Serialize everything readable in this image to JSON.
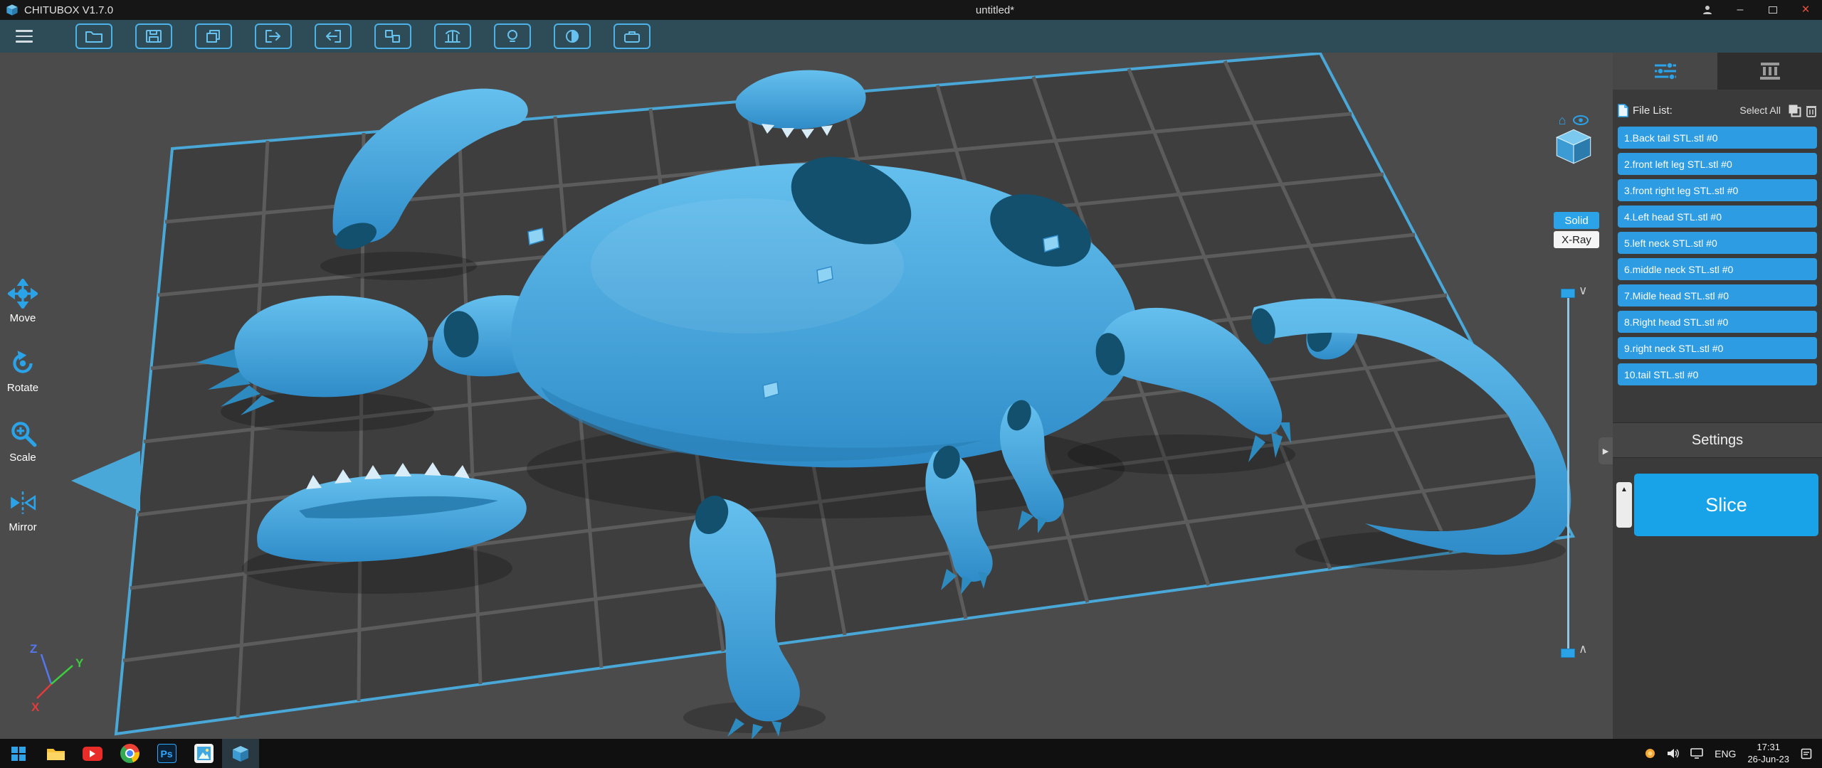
{
  "colors": {
    "accent": "#2ba3e8",
    "model_blue": "#3fa8e0",
    "slice_blue": "#18a3e8",
    "toolbar_bg": "#2d4c58",
    "viewport_bg": "#4b4b4b",
    "panel_bg": "#3a3a3a",
    "plate_outline": "#49a8d8",
    "close_red": "#ef5340"
  },
  "title_bar": {
    "app_title": "CHITUBOX V1.7.0",
    "document_title": "untitled*"
  },
  "toolbar": {
    "button_icons": [
      "open-file",
      "save",
      "copy",
      "import",
      "export",
      "clone",
      "support",
      "hollow",
      "dark-mode",
      "print-settings"
    ]
  },
  "left_toolbar": {
    "tools": [
      {
        "icon": "move-icon",
        "label": "Move"
      },
      {
        "icon": "rotate-icon",
        "label": "Rotate"
      },
      {
        "icon": "scale-icon",
        "label": "Scale"
      },
      {
        "icon": "mirror-icon",
        "label": "Mirror"
      }
    ]
  },
  "viewport": {
    "render_modes": {
      "solid": "Solid",
      "xray": "X-Ray"
    },
    "view_widget_icons": [
      "home-icon",
      "eye-icon",
      "view-cube"
    ],
    "axes": {
      "x": "X",
      "y": "Y",
      "z": "Z"
    }
  },
  "right_panel": {
    "tabs": [
      {
        "icon": "settings-sliders-icon",
        "active": true
      },
      {
        "icon": "printer-icon",
        "active": false
      }
    ],
    "file_list": {
      "label": "File List:",
      "select_all_label": "Select All",
      "icons": [
        "file-icon",
        "select-all-icon",
        "delete-icon"
      ],
      "files": [
        "1.Back tail STL.stl #0",
        "2.front left leg STL.stl #0",
        "3.front right leg STL.stl #0",
        "4.Left head STL.stl #0",
        "5.left neck STL.stl #0",
        "6.middle neck STL.stl #0",
        "7.Midle head STL.stl #0",
        "8.Right head STL.stl #0",
        "9.right neck STL.stl #0",
        "10.tail STL.stl #0"
      ]
    },
    "settings_button": "Settings",
    "slice_button": "Slice"
  },
  "taskbar": {
    "apps": [
      "windows-start",
      "file-explorer",
      "youtube",
      "chrome",
      "photoshop",
      "photos",
      "chitubox"
    ],
    "active_app": "chitubox",
    "app_labels": {
      "photoshop": "Ps"
    },
    "tray": {
      "icons": [
        "tray-app-icon",
        "volume-icon",
        "display-icon",
        "notification-icon"
      ],
      "language": "ENG",
      "time": "17:31",
      "date": "26-Jun-23"
    }
  }
}
